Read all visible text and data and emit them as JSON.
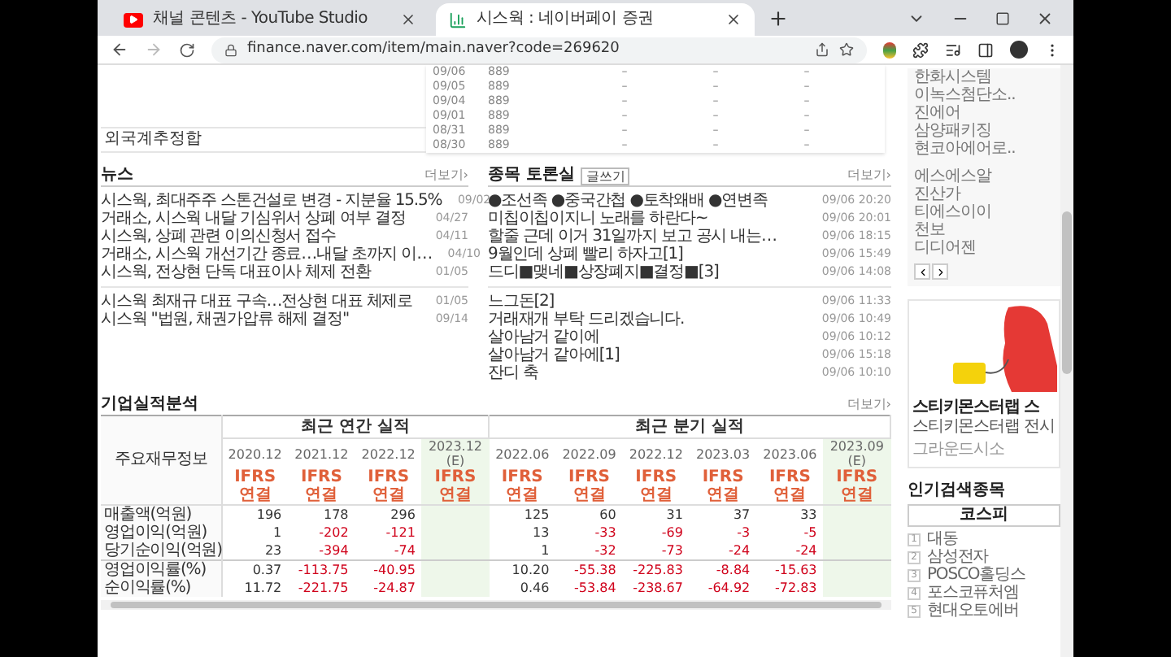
{
  "browser": {
    "tabs": [
      {
        "title": "채널 콘텐츠 - YouTube Studio",
        "kind": "video",
        "selected": false
      },
      {
        "title": "시스웍 : 네이버페이 증권",
        "kind": "chart",
        "selected": true
      }
    ],
    "url": "finance.naver.com/item/main.naver?code=269620"
  },
  "trading_table": {
    "label": "외국계추정합",
    "rows": [
      [
        "09/06",
        "889",
        "–",
        "–",
        "–"
      ],
      [
        "09/05",
        "889",
        "–",
        "–",
        "–"
      ],
      [
        "09/04",
        "889",
        "–",
        "–",
        "–"
      ],
      [
        "09/01",
        "889",
        "–",
        "–",
        "–"
      ],
      [
        "08/31",
        "889",
        "–",
        "–",
        "–"
      ],
      [
        "08/30",
        "889",
        "–",
        "–",
        "–"
      ]
    ]
  },
  "news": {
    "title": "뉴스",
    "more": "더보기›",
    "groups": [
      [
        {
          "title": "시스웍, 최대주주 스톤건설로 변경 - 지분율 15.5%",
          "date": "09/02"
        },
        {
          "title": "거래소, 시스웍 내달 기심위서 상폐 여부 결정",
          "date": "04/27"
        },
        {
          "title": "시스웍, 상폐 관련 이의신청서 접수",
          "date": "04/11"
        },
        {
          "title": "거래소, 시스웍 개선기간 종료…내달 초까지 이…",
          "date": "04/10"
        },
        {
          "title": "시스웍, 전상현 단독 대표이사 체제 전환",
          "date": "01/05"
        }
      ],
      [
        {
          "title": "시스웍 최재규 대표 구속…전상현 대표 체제로",
          "date": "01/05"
        },
        {
          "title": "시스웍 \"법원, 채권가압류 해제 결정\"",
          "date": "09/14"
        }
      ]
    ]
  },
  "discussion": {
    "title": "종목 토론실",
    "write_button": "글쓰기",
    "more": "더보기›",
    "groups": [
      [
        {
          "title": "●조선족 ●중국간첩 ●토착왜배 ●연변족",
          "date": "09/06 20:20"
        },
        {
          "title": "미칩이칩이지니 노래를 하란다~",
          "date": "09/06 20:01"
        },
        {
          "title": "할줄 근데 이거 31일까지 보고 공시 내는…",
          "date": "09/06 18:15"
        },
        {
          "title": "9월인데 상폐 빨리 하자고[1]",
          "date": "09/06 15:49"
        },
        {
          "title": "드디■맺네■상장폐지■결정■[3]",
          "date": "09/06 14:08"
        }
      ],
      [
        {
          "title": "느그돈[2]",
          "date": "09/06 11:33"
        },
        {
          "title": "거래재개 부탁 드리겠습니다.",
          "date": "09/06 10:49"
        },
        {
          "title": "살아남거 같이에",
          "date": "09/06 10:12"
        },
        {
          "title": "살아남거 같아에[1]",
          "date": "09/06 15:18"
        },
        {
          "title": "잔디 축",
          "date": "09/06 10:10"
        }
      ]
    ]
  },
  "financials": {
    "title": "기업실적분석",
    "more": "더보기›",
    "row_header": "주요재무정보",
    "groups": [
      {
        "label": "최근 연간 실적",
        "periods": [
          {
            "label": "2020.12",
            "basis": [
              "IFRS",
              "연결"
            ],
            "estimate": false
          },
          {
            "label": "2021.12",
            "basis": [
              "IFRS",
              "연결"
            ],
            "estimate": false
          },
          {
            "label": "2022.12",
            "basis": [
              "IFRS",
              "연결"
            ],
            "estimate": false
          },
          {
            "label": "2023.12",
            "note": "(E)",
            "basis": [
              "IFRS",
              "연결"
            ],
            "estimate": true
          }
        ]
      },
      {
        "label": "최근 분기 실적",
        "periods": [
          {
            "label": "2022.06",
            "basis": [
              "IFRS",
              "연결"
            ],
            "estimate": false
          },
          {
            "label": "2022.09",
            "basis": [
              "IFRS",
              "연결"
            ],
            "estimate": false
          },
          {
            "label": "2022.12",
            "basis": [
              "IFRS",
              "연결"
            ],
            "estimate": false
          },
          {
            "label": "2023.03",
            "basis": [
              "IFRS",
              "연결"
            ],
            "estimate": false
          },
          {
            "label": "2023.06",
            "basis": [
              "IFRS",
              "연결"
            ],
            "estimate": false
          },
          {
            "label": "2023.09",
            "note": "(E)",
            "basis": [
              "IFRS",
              "연결"
            ],
            "estimate": true
          }
        ]
      }
    ],
    "rows": [
      {
        "label": "매출액(억원)",
        "values": [
          [
            "196",
            "178",
            "296"
          ],
          [
            "125",
            "60",
            "31",
            "37",
            "33"
          ]
        ]
      },
      {
        "label": "영업이익(억원)",
        "values": [
          [
            "1",
            "-202",
            "-121"
          ],
          [
            "13",
            "-33",
            "-69",
            "-3",
            "-5"
          ]
        ]
      },
      {
        "label": "당기순이익(억원)",
        "values": [
          [
            "23",
            "-394",
            "-74"
          ],
          [
            "1",
            "-32",
            "-73",
            "-24",
            "-24"
          ]
        ]
      },
      {
        "label": "영업이익률(%)",
        "values": [
          [
            "0.37",
            "-113.75",
            "-40.95"
          ],
          [
            "10.20",
            "-55.38",
            "-225.83",
            "-8.84",
            "-15.63"
          ]
        ]
      },
      {
        "label": "순이익률(%)",
        "values": [
          [
            "11.72",
            "-221.75",
            "-24.87"
          ],
          [
            "0.46",
            "-53.84",
            "-238.67",
            "-64.92",
            "-72.83"
          ]
        ]
      }
    ]
  },
  "sidebar": {
    "stock_groups": [
      [
        "한화시스템",
        "이녹스첨단소..",
        "진에어",
        "삼양패키징",
        "현코아에어로.."
      ],
      [
        "에스에스알",
        "진산가",
        "티에스이이",
        "천보",
        "디디어젠"
      ]
    ],
    "ad": {
      "lines": [
        "스티키몬스터랩 스",
        "스티키몬스터랩 전시",
        "그라운드시소"
      ]
    },
    "popular": {
      "title": "인기검색종목",
      "tabs": [
        {
          "label": "코스피",
          "selected": true
        }
      ],
      "items": [
        {
          "rank": "1",
          "name": "대동"
        },
        {
          "rank": "2",
          "name": "삼성전자"
        },
        {
          "rank": "3",
          "name": "POSCO홀딩스"
        },
        {
          "rank": "4",
          "name": "포스코퓨처엠"
        },
        {
          "rank": "5",
          "name": "현대오토에버"
        }
      ]
    }
  }
}
